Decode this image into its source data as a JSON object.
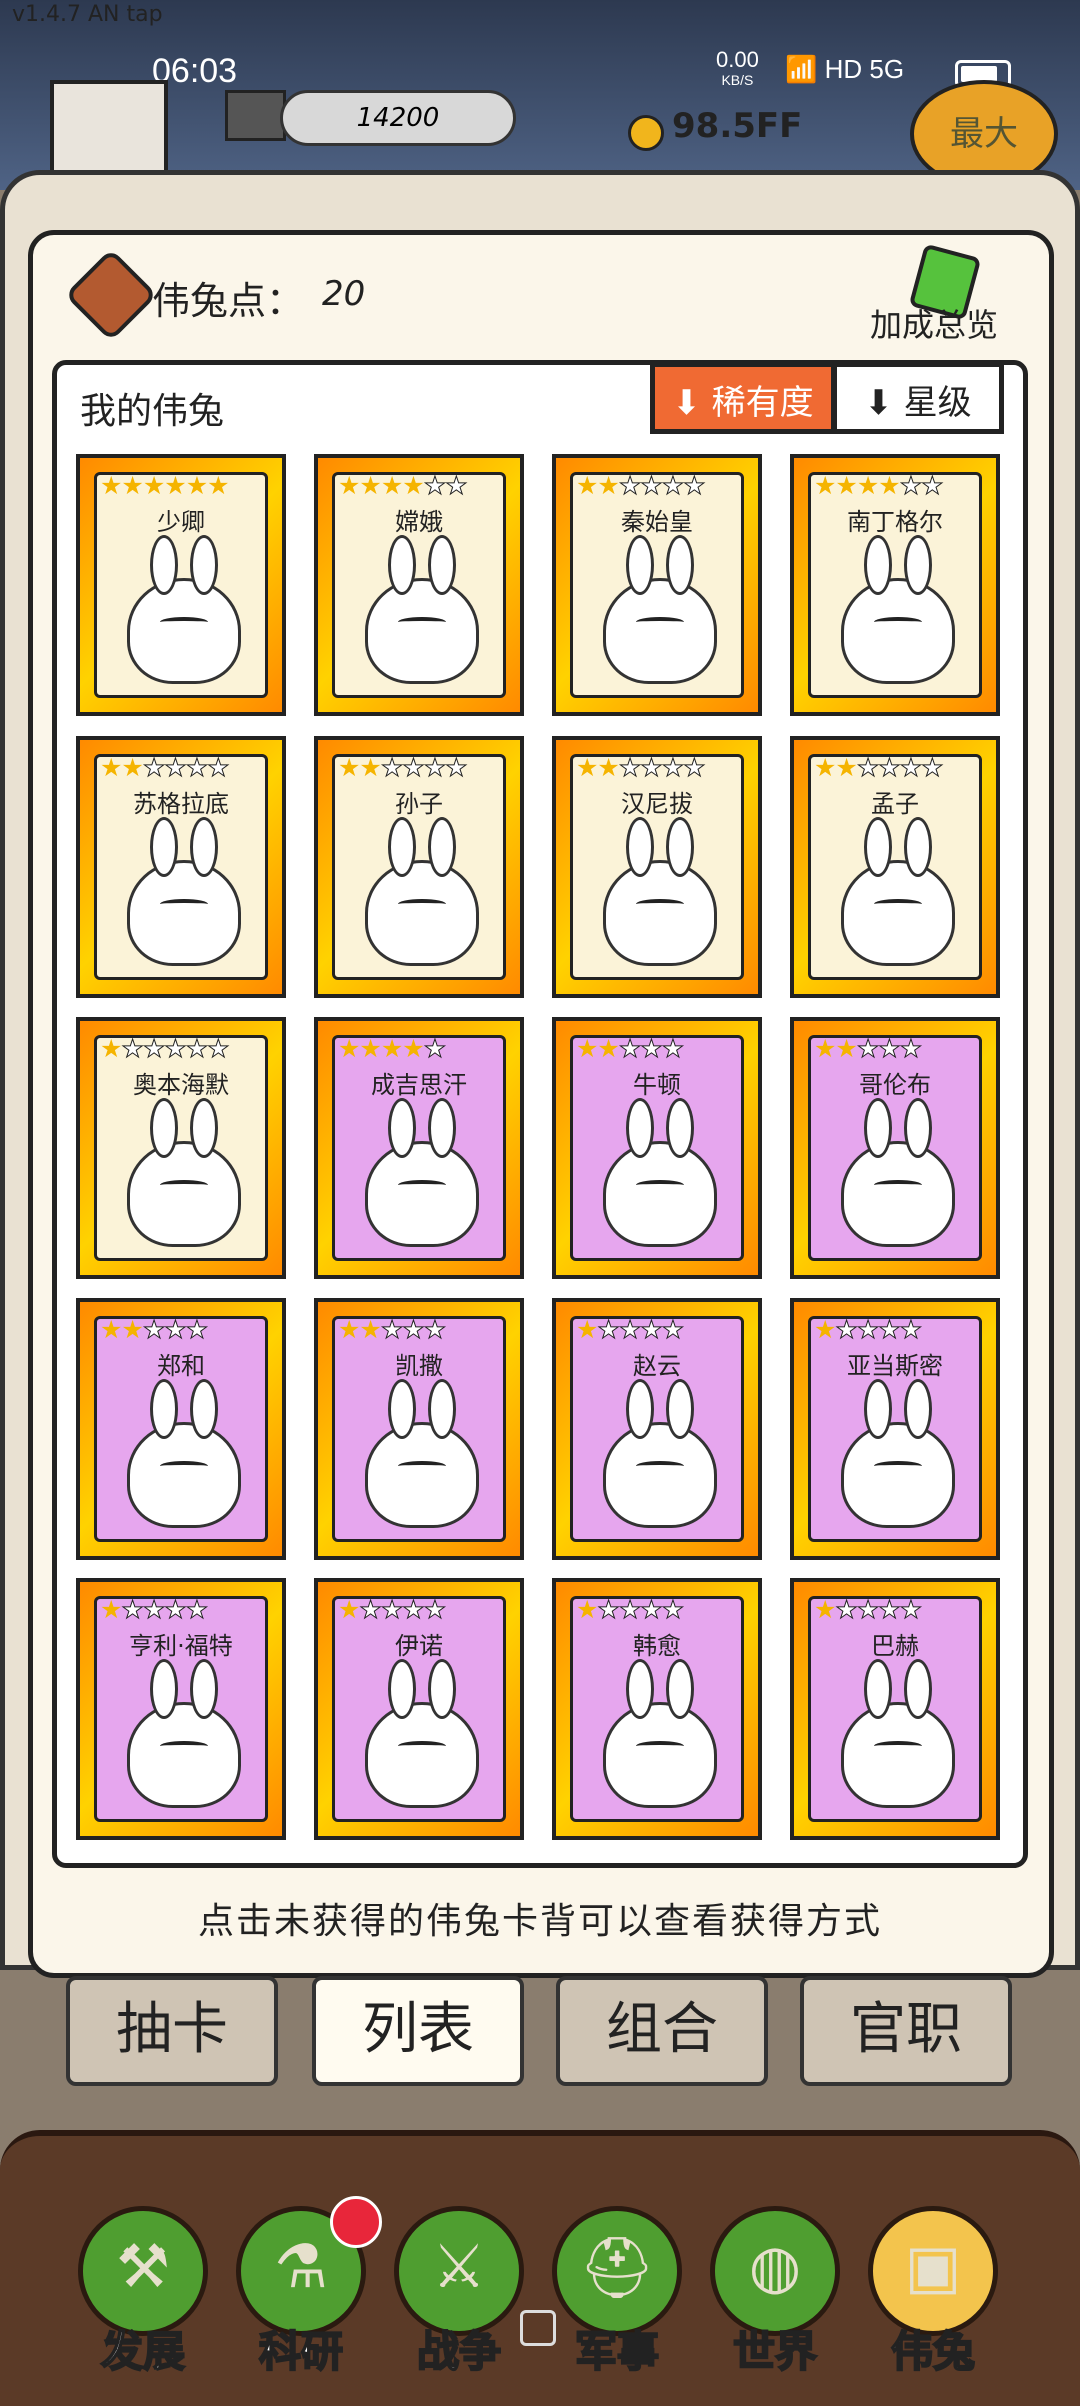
{
  "version": "v1.4.7 AN tap",
  "status": {
    "time": "06:03",
    "net_speed": "0.00",
    "net_unit": "KB/S",
    "icons": "📶 HD 5G"
  },
  "topbar": {
    "score": "14200",
    "money": "98.5FF",
    "max_label": "最大"
  },
  "points": {
    "label": "伟兔点：",
    "value": "20"
  },
  "bonus_label": "加成总览",
  "list": {
    "title": "我的伟兔",
    "sort_rarity": "⬇ 稀有度",
    "sort_star": "⬇ 星级"
  },
  "cards": [
    {
      "name": "少卿",
      "stars": 6,
      "tier": "gold"
    },
    {
      "name": "嫦娥",
      "stars": 6,
      "tier": "gold"
    },
    {
      "name": "秦始皇",
      "stars": 6,
      "tier": "gold"
    },
    {
      "name": "南丁格尔",
      "stars": 6,
      "tier": "gold"
    },
    {
      "name": "苏格拉底",
      "stars": 6,
      "tier": "gold"
    },
    {
      "name": "孙子",
      "stars": 6,
      "tier": "gold"
    },
    {
      "name": "汉尼拔",
      "stars": 6,
      "tier": "gold"
    },
    {
      "name": "孟子",
      "stars": 6,
      "tier": "gold"
    },
    {
      "name": "奥本海默",
      "stars": 6,
      "tier": "gold"
    },
    {
      "name": "成吉思汗",
      "stars": 5,
      "tier": "purple"
    },
    {
      "name": "牛顿",
      "stars": 5,
      "tier": "purple"
    },
    {
      "name": "哥伦布",
      "stars": 5,
      "tier": "purple"
    },
    {
      "name": "郑和",
      "stars": 5,
      "tier": "purple"
    },
    {
      "name": "凯撒",
      "stars": 5,
      "tier": "purple"
    },
    {
      "name": "赵云",
      "stars": 5,
      "tier": "purple"
    },
    {
      "name": "亚当斯密",
      "stars": 5,
      "tier": "purple"
    },
    {
      "name": "亨利·福特",
      "stars": 5,
      "tier": "purple"
    },
    {
      "name": "伊诺",
      "stars": 5,
      "tier": "purple"
    },
    {
      "name": "韩愈",
      "stars": 5,
      "tier": "purple"
    },
    {
      "name": "巴赫",
      "stars": 5,
      "tier": "purple"
    }
  ],
  "star_levels": [
    6,
    4,
    2,
    4,
    2,
    2,
    2,
    2,
    1,
    4,
    2,
    2,
    2,
    2,
    1,
    1,
    1,
    1,
    1,
    1
  ],
  "hint": "点击未获得的伟兔卡背可以查看获得方式",
  "tabs": [
    {
      "label": "抽卡"
    },
    {
      "label": "列表"
    },
    {
      "label": "组合"
    },
    {
      "label": "官职"
    }
  ],
  "nav": [
    {
      "label": "发展",
      "icon": "axe-icon",
      "glyph": "⚒"
    },
    {
      "label": "科研",
      "icon": "flask-icon",
      "glyph": "⚗"
    },
    {
      "label": "战争",
      "icon": "swords-icon",
      "glyph": "⚔"
    },
    {
      "label": "军事",
      "icon": "helmet-icon",
      "glyph": "⛑"
    },
    {
      "label": "世界",
      "icon": "globe-icon",
      "glyph": "◍"
    },
    {
      "label": "伟兔",
      "icon": "rabbit-card-icon",
      "glyph": "▣"
    }
  ]
}
